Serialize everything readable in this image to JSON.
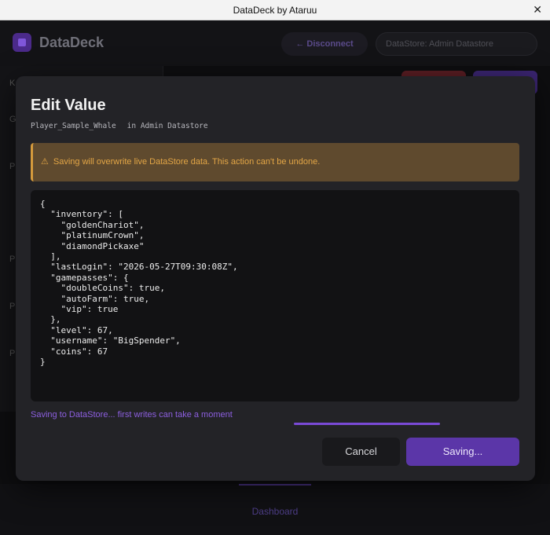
{
  "window": {
    "title": "DataDeck by Ataruu"
  },
  "app": {
    "brand": "DataDeck",
    "disconnect_label": "← Disconnect",
    "datastore_label": "DataStore: Admin Datastore",
    "sidebar_keys": [
      "K",
      "G",
      "P",
      "P",
      "P",
      "P"
    ],
    "footer_nav": "Dashboard"
  },
  "modal": {
    "title": "Edit Value",
    "key": "Player_Sample_Whale",
    "datastore": "in Admin Datastore",
    "warning_icon": "⚠",
    "warning": "Saving will overwrite live DataStore data. This action can't be undone.",
    "editor_value": "{\n  \"inventory\": [\n    \"goldenChariot\",\n    \"platinumCrown\",\n    \"diamondPickaxe\"\n  ],\n  \"lastLogin\": \"2026-05-27T09:30:08Z\",\n  \"gamepasses\": {\n    \"doubleCoins\": true,\n    \"autoFarm\": true,\n    \"vip\": true\n  },\n  \"level\": 67,\n  \"username\": \"BigSpender\",\n  \"coins\": 67\n}",
    "saving_message": "Saving to DataStore... first writes can take a moment",
    "cancel_label": "Cancel",
    "save_label": "Saving..."
  },
  "colors": {
    "accent": "#5b36a8",
    "warning": "#e3a646"
  }
}
